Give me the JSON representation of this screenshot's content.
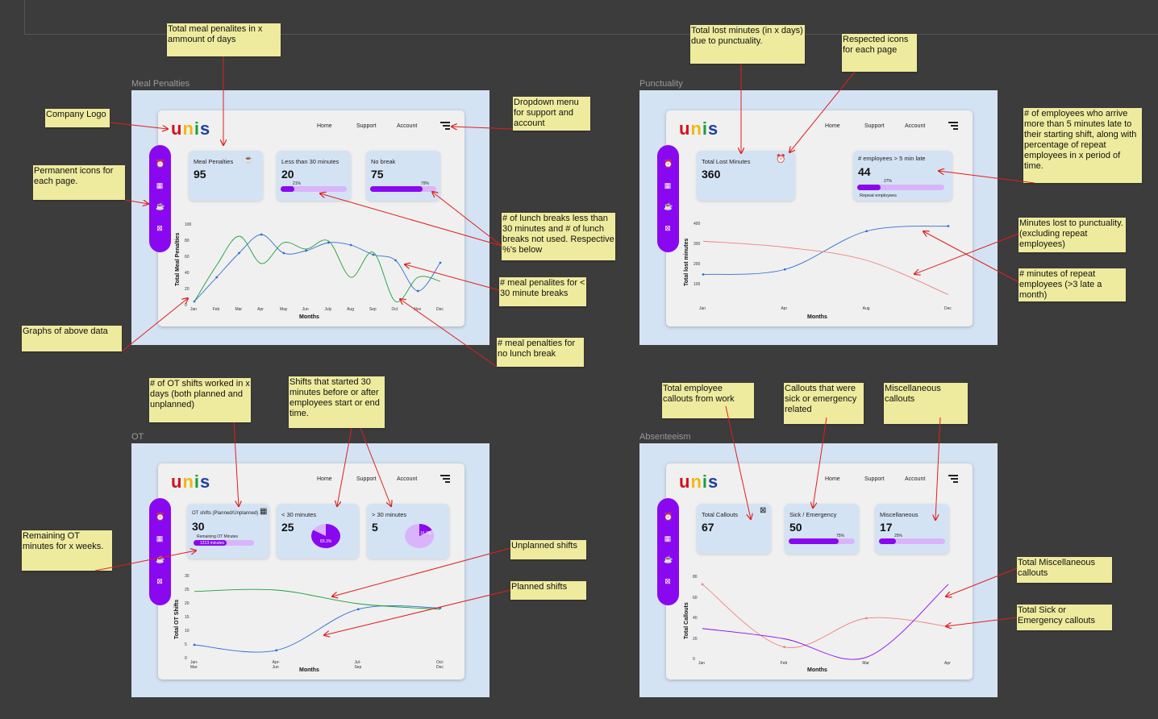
{
  "brand": {
    "logo": [
      "u",
      "n",
      "i",
      "s"
    ]
  },
  "nav": {
    "home": "Home",
    "support": "Support",
    "account": "Account"
  },
  "frames": {
    "meal": {
      "label": "Meal Penalties"
    },
    "punct": {
      "label": "Punctuality"
    },
    "ot": {
      "label": "OT"
    },
    "abs": {
      "label": "Absenteeism"
    }
  },
  "meal": {
    "s1": {
      "label": "Meal Penalties",
      "value": "95"
    },
    "s2": {
      "label": "Less than 30 minutes",
      "value": "20",
      "pct": "21%",
      "fill": 0.21
    },
    "s3": {
      "label": "No break",
      "value": "75",
      "pct": "79%",
      "fill": 0.79
    },
    "ylabel": "Total Meal Penalties",
    "xlabel": "Months"
  },
  "punct": {
    "s1": {
      "label": "Total Lost Minutes",
      "value": "360"
    },
    "s2": {
      "label": "# employees > 5 min late",
      "value": "44",
      "pct": "27%",
      "fill": 0.27,
      "sub": "Repeat employees"
    },
    "ylabel": "Total lost minutes",
    "xlabel": "Months"
  },
  "ot": {
    "s1": {
      "label": "OT shifts (Planned/Unplanned)",
      "value": "30",
      "sub": "Remaining OT Minutes",
      "bar": "1213 minutes",
      "fill": 0.55
    },
    "s2": {
      "label": "< 30 minutes",
      "value": "25",
      "pct": "83.3%",
      "share": 0.833
    },
    "s3": {
      "label": "> 30 minutes",
      "value": "5",
      "pct": "16.7%",
      "share": 0.167
    },
    "ylabel": "Total OT Shifts",
    "xlabel": "Months"
  },
  "abs": {
    "s1": {
      "label": "Total Callouts",
      "value": "67"
    },
    "s2": {
      "label": "Sick / Emergency",
      "value": "50",
      "pct": "75%",
      "fill": 0.75
    },
    "s3": {
      "label": "Miscellaneous",
      "value": "17",
      "pct": "25%",
      "fill": 0.25
    },
    "ylabel": "Total Callouts",
    "xlabel": "Months"
  },
  "notes": {
    "n1": "Total meal penalites in x ammount of days",
    "n2": "Company Logo",
    "n3": "Dropdown menu for support and account",
    "n4": "Permanent icons for each page.",
    "n5": "# of lunch breaks less than 30 minutes and # of lunch breaks not used. Respective %'s below",
    "n6": "# meal penalites for < 30 minute breaks",
    "n7": "Graphs of above data",
    "n8": "# meal penalties for no lunch break",
    "n9": "Total lost minutes (in x days) due to punctuality.",
    "n10": "Respected icons for each page",
    "n11": "# of employees who arrive more than 5 minutes late to their starting shift, along with percentage of repeat employees in x period of time.",
    "n12": "Minutes lost to punctuality. (excluding repeat employees)",
    "n13": "# minutes of repeat employees (>3 late a month)",
    "n14": "# of OT shifts worked in x days (both planned and unplanned)",
    "n15": "Shifts that started 30 minutes before or after employees start or end time.",
    "n16": "Remaining OT minutes for x weeks.",
    "n17": "Unplanned shifts",
    "n18": "Planned shifts",
    "n19": "Total employee callouts from work",
    "n20": "Callouts that were sick or emergency related",
    "n21": "Miscellaneous callouts",
    "n22": "Total Miscellaneous callouts",
    "n23": "Total Sick or Emergency callouts"
  },
  "colors": {
    "purple": "#8a08f0",
    "lightpurple": "#d9b4fb",
    "green": "#1aa03b",
    "blue": "#2f6fd1",
    "salmon": "#f08080",
    "note": "#eeeb9e",
    "frame": "#d4e3f3"
  },
  "chart_data": [
    {
      "type": "line",
      "id": "meal",
      "ylabel": "Total Meal Penalties",
      "xlabel": "Months",
      "ylim": [
        0,
        100
      ],
      "categories": [
        "Jan",
        "Feb",
        "Mar",
        "Apr",
        "May",
        "Jun",
        "July",
        "Aug",
        "Sep",
        "Oct",
        "Nov",
        "Dec"
      ],
      "yticks": [
        0,
        20,
        40,
        60,
        80,
        100
      ],
      "series": [
        {
          "values": [
            5,
            35,
            65,
            88,
            65,
            68,
            78,
            75,
            63,
            56,
            18,
            53
          ],
          "color": "#2f6fd1"
        },
        {
          "values": [
            5,
            50,
            86,
            52,
            78,
            70,
            80,
            35,
            66,
            5,
            35,
            30
          ],
          "color": "#1aa03b"
        }
      ]
    },
    {
      "type": "line",
      "id": "punct",
      "ylabel": "Total lost minutes",
      "xlabel": "Months",
      "ylim": [
        0,
        400
      ],
      "categories": [
        "Jan",
        "Apr",
        "Aug",
        "Dec"
      ],
      "yticks": [
        100,
        200,
        300,
        400
      ],
      "series": [
        {
          "values": [
            150,
            175,
            365,
            390
          ],
          "color": "#2f6fd1"
        },
        {
          "values": [
            315,
            285,
            220,
            50
          ],
          "color": "#f08080"
        }
      ]
    },
    {
      "type": "line",
      "id": "ot",
      "ylabel": "Total OT Shifts",
      "xlabel": "Months",
      "ylim": [
        0,
        30
      ],
      "categories": [
        "Jan-Mar",
        "Apr-Jun",
        "Jul-Sep",
        "Oct-Dec"
      ],
      "yticks": [
        0,
        5,
        10,
        15,
        20,
        25,
        30
      ],
      "series": [
        {
          "values": [
            5,
            3,
            18,
            18.5
          ],
          "color": "#2f6fd1"
        },
        {
          "values": [
            24.5,
            25,
            20,
            18
          ],
          "color": "#1aa03b"
        }
      ]
    },
    {
      "type": "line",
      "id": "abs",
      "ylabel": "Total Callouts",
      "xlabel": "Months",
      "ylim": [
        0,
        80
      ],
      "categories": [
        "Jan",
        "Feb",
        "Mar",
        "Apr"
      ],
      "yticks": [
        0,
        20,
        40,
        60,
        80
      ],
      "series": [
        {
          "values": [
            73,
            12,
            40,
            32
          ],
          "color": "#f08080"
        },
        {
          "values": [
            30,
            20,
            2,
            73
          ],
          "color": "#8a08f0"
        }
      ]
    }
  ]
}
